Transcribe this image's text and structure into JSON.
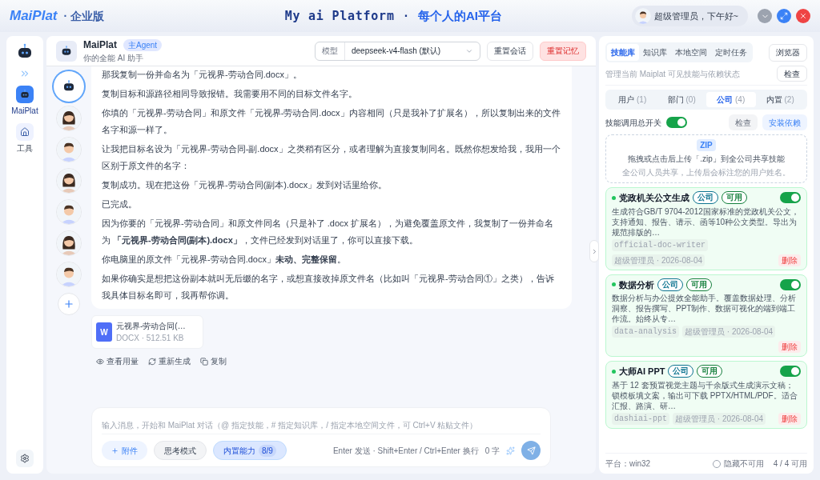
{
  "header": {
    "logo": "MaiPlat",
    "edition_separator": "·",
    "edition": "企业版",
    "slogan_left": "My ai Platform",
    "slogan_separator": "·",
    "slogan_right": "每个人的AI平台",
    "greeting": "超级管理员，下午好~"
  },
  "rail": {
    "items": [
      {
        "label": "MaiPlat",
        "kind": "chat",
        "selected": true
      },
      {
        "label": "工具",
        "kind": "home",
        "selected": false
      }
    ]
  },
  "chat_header": {
    "name": "MaiPlat",
    "badge": "主Agent",
    "subtitle": "你的全能 AI 助手",
    "model_label": "模型",
    "model_value": "deepseek-v4-flash (默认)",
    "buttons": [
      {
        "label": "重置会话",
        "kind": "normal"
      },
      {
        "label": "重置记忆",
        "kind": "danger"
      }
    ]
  },
  "agents": [
    {
      "kind": "robot",
      "selected": true
    },
    {
      "kind": "female",
      "selected": false
    },
    {
      "kind": "male",
      "selected": false
    },
    {
      "kind": "female",
      "selected": false
    },
    {
      "kind": "male",
      "selected": false
    },
    {
      "kind": "female",
      "selected": false
    },
    {
      "kind": "male",
      "selected": false
    }
  ],
  "message": {
    "paragraphs": [
      "那我复制一份并命名为「元视界-劳动合同.docx」。",
      "复制目标和源路径相同导致报错。我需要用不同的目标文件名字。",
      "你填的「元视界-劳动合同」和原文件「元视界-劳动合同.docx」内容相同（只是我补了扩展名），所以复制出来的文件名字和源一样了。",
      "让我把目标名设为「元视界-劳动合同-副.docx」之类稍有区分，或者理解为直接复制同名。既然你想发给我，我用一个区别于原文件的名字：",
      "复制成功。现在把这份「元视界-劳动合同(副本).docx」发到对话里给你。",
      "已完成。",
      "因为你要的「元视界-劳动合同」和原文件同名（只是补了 .docx 扩展名），为避免覆盖原文件，我复制了一份并命名为 **「元视界-劳动合同(副本).docx」**，文件已经发到对话里了，你可以直接下载。",
      "你电脑里的原文件「元视界-劳动合同.docx」**未动、完整保留**。",
      "如果你确实是想把这份副本就叫无后缀的名字，或想直接改掉原文件名（比如叫「元视界-劳动合同①」之类），告诉我具体目标名即可，我再帮你调。"
    ]
  },
  "attachment": {
    "icon_letter": "W",
    "name": "元视界-劳动合同(…",
    "meta": "DOCX · 512.51 KB"
  },
  "actions": [
    {
      "label": "查看用量",
      "kind": "eye"
    },
    {
      "label": "重新生成",
      "kind": "refresh"
    },
    {
      "label": "复制",
      "kind": "copy"
    }
  ],
  "composer": {
    "placeholder": "输入消息，开始和 MaiPlat 对话（@ 指定技能，# 指定知识库，/ 指定本地空间文件，可 Ctrl+V 粘贴文件）",
    "attach": "附件",
    "think": "思考模式",
    "builtin": "内置能力",
    "builtin_count": "8/9",
    "hint": "Enter 发送 · Shift+Enter / Ctrl+Enter 换行",
    "char_count": "0 字"
  },
  "side_panel": {
    "tabs": [
      {
        "label": "技能库",
        "selected": true
      },
      {
        "label": "知识库",
        "selected": false
      },
      {
        "label": "本地空间",
        "selected": false
      },
      {
        "label": "定时任务",
        "selected": false
      }
    ],
    "browser": "浏览器",
    "description": "管理当前 Maiplat 可见技能与依赖状态",
    "check": "检查",
    "scopes": [
      {
        "label": "用户",
        "count": "(1)",
        "selected": false
      },
      {
        "label": "部门",
        "count": "(0)",
        "selected": false
      },
      {
        "label": "公司",
        "count": "(4)",
        "selected": true
      },
      {
        "label": "内置",
        "count": "(2)",
        "selected": false
      }
    ],
    "master_switch": {
      "label": "技能调用总开关",
      "on": true
    },
    "check2": "检查",
    "install": "安装依赖",
    "upload": {
      "badge": "ZIP",
      "title": "拖拽或点击后上传「.zip」到全公司共享技能",
      "subtitle": "全公司人员共享，上传后会标注您的用户姓名。"
    },
    "skills": [
      {
        "name": "党政机关公文生成",
        "enabled": true,
        "tags": [
          {
            "label": "公司",
            "color": "#0e7490"
          },
          {
            "label": "可用",
            "color": "#15803d"
          }
        ],
        "description": "生成符合GB/T 9704-2012国家标准的党政机关公文，支持通知、报告、请示、函等10种公文类型。导出为规范排版的…",
        "slug": "official-doc-writer",
        "owner": "超级管理员 · 2026-08-04",
        "delete": "删除"
      },
      {
        "name": "数据分析",
        "enabled": true,
        "tags": [
          {
            "label": "公司",
            "color": "#0e7490"
          },
          {
            "label": "可用",
            "color": "#15803d"
          }
        ],
        "description": "数据分析与办公提效全能助手。覆盖数据处理、分析洞察、报告撰写、PPT制作、数据可视化的端到端工作流。始终从专…",
        "slug": "data-analysis",
        "owner": "超级管理员 · 2026-08-04",
        "delete": "删除"
      },
      {
        "name": "大师AI PPT",
        "enabled": true,
        "tags": [
          {
            "label": "公司",
            "color": "#0e7490"
          },
          {
            "label": "可用",
            "color": "#15803d"
          }
        ],
        "description": "基于 12 套预置视觉主题与千余版式生成演示文稿；锁模板填文案，输出可下载 PPTX/HTML/PDF。适合汇报、路演、研…",
        "slug": "dashiai-ppt",
        "owner": "超级管理员 · 2026-08-04",
        "delete": "删除"
      }
    ],
    "footer": {
      "platform": "平台：win32",
      "hide_label": "隐藏不可用",
      "hide_checked": false,
      "count": "4 / 4 可用"
    }
  }
}
